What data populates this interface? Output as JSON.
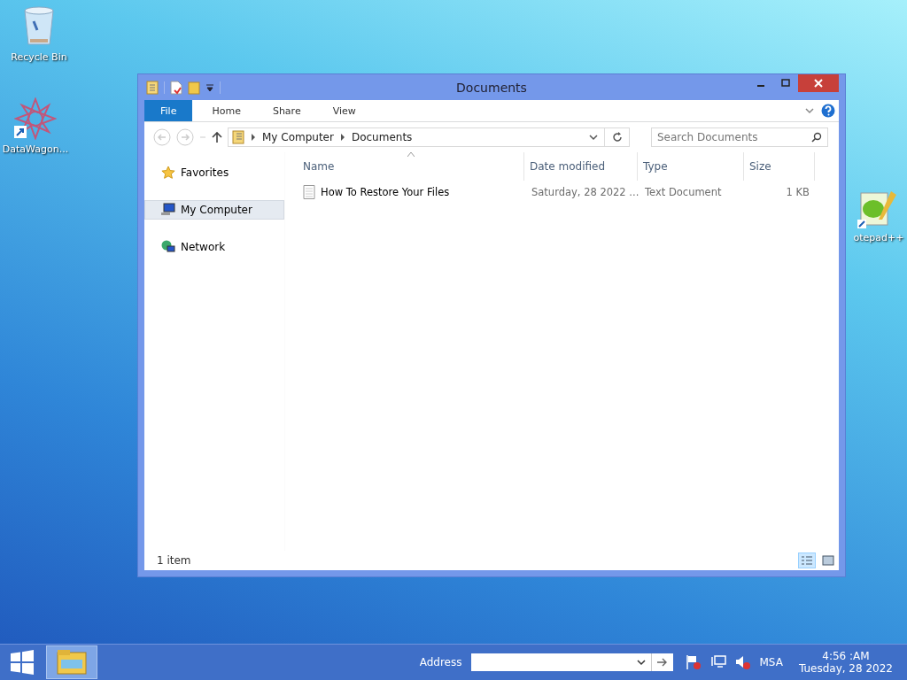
{
  "desktop_icons": [
    {
      "label": "Recycle Bin",
      "kind": "recycle"
    },
    {
      "label": "DataWagon...",
      "kind": "app"
    },
    {
      "label": "otepad++",
      "kind": "notepad"
    }
  ],
  "window": {
    "title": "Documents",
    "ribbon_tabs": [
      {
        "label": "File",
        "kind": "file"
      },
      {
        "label": "Home",
        "kind": "tab"
      },
      {
        "label": "Share",
        "kind": "tab"
      },
      {
        "label": "View",
        "kind": "tab"
      }
    ],
    "breadcrumbs": [
      "My Computer",
      "Documents"
    ],
    "search": {
      "placeholder": "Search Documents"
    },
    "nav_items": [
      {
        "label": "Favorites",
        "kind": "star",
        "selected": false
      },
      {
        "label": "My Computer",
        "kind": "computer",
        "selected": true
      },
      {
        "label": "Network",
        "kind": "network",
        "selected": false
      }
    ],
    "columns": [
      "Name",
      "Date modified",
      "Type",
      "Size"
    ],
    "rows": [
      {
        "name": "How To Restore Your Files",
        "date": "Saturday, 28 2022 ...",
        "type": "Text Document",
        "size": "1 KB",
        "selected": false
      }
    ],
    "status": "1 item",
    "view_buttons": [
      {
        "kind": "details",
        "selected": true
      },
      {
        "kind": "icons",
        "selected": false
      }
    ]
  },
  "taskbar": {
    "address_label": "Address",
    "tray_label": "MSA",
    "time": "4:56 :AM",
    "date": "Tuesday, 28 2022"
  }
}
